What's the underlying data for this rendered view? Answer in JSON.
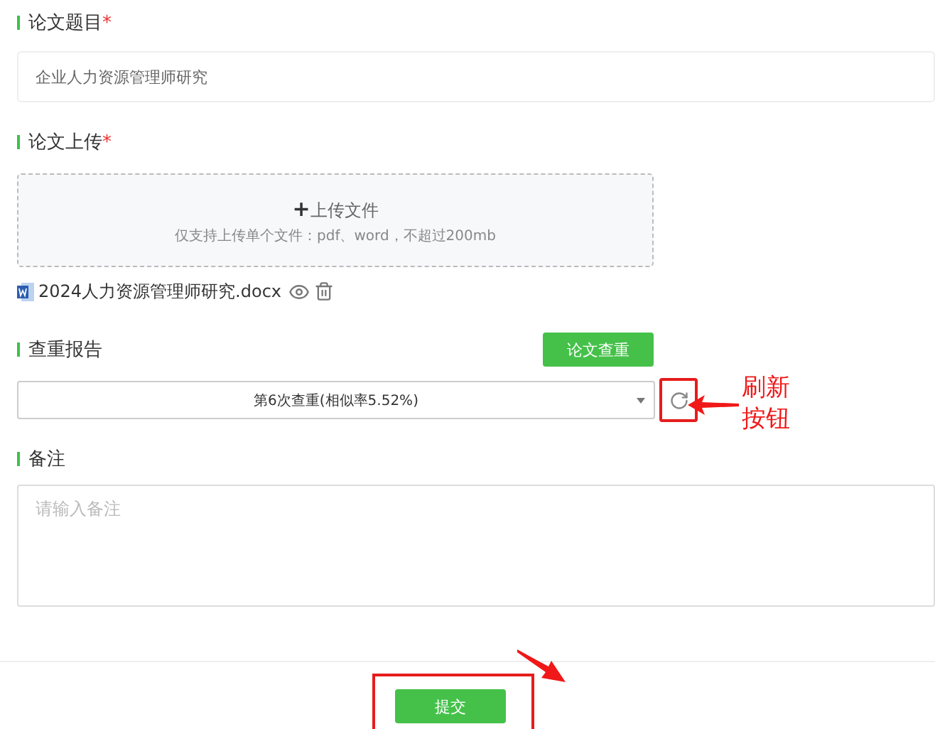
{
  "title_field": {
    "label": "论文题目",
    "required_mark": "*",
    "value": "企业人力资源管理师研究"
  },
  "upload": {
    "label": "论文上传",
    "required_mark": "*",
    "plus": "+",
    "button_text": "上传文件",
    "hint": "仅支持上传单个文件：pdf、word，不超过200mb",
    "file_name": "2024人力资源管理师研究.docx"
  },
  "report": {
    "label": "查重报告",
    "check_button": "论文查重",
    "selected_report": "第6次查重(相似率5.52%)"
  },
  "remarks": {
    "label": "备注",
    "placeholder": "请输入备注"
  },
  "submit": "提交",
  "annotations": [
    {
      "kind": "refresh",
      "lines": [
        "刷新",
        "按钮"
      ]
    },
    {
      "kind": "submit"
    }
  ]
}
